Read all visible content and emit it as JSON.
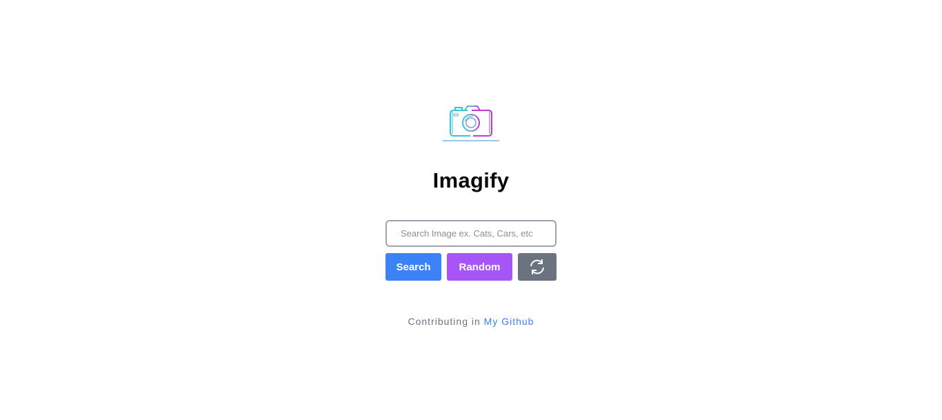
{
  "app": {
    "title": "Imagify",
    "logo_icon": "camera-icon"
  },
  "search": {
    "placeholder": "Search Image ex. Cats, Cars, etc",
    "value": ""
  },
  "buttons": {
    "search_label": "Search",
    "random_label": "Random",
    "refresh_icon": "refresh-icon"
  },
  "footer": {
    "text": "Contributing in",
    "link_label": "My Github"
  },
  "colors": {
    "search_button": "#3b82f6",
    "random_button": "#a855f7",
    "refresh_button": "#6b7280",
    "link": "#3b82f6",
    "logo_cyan": "#3cc3d8",
    "logo_magenta": "#c13ccf"
  }
}
